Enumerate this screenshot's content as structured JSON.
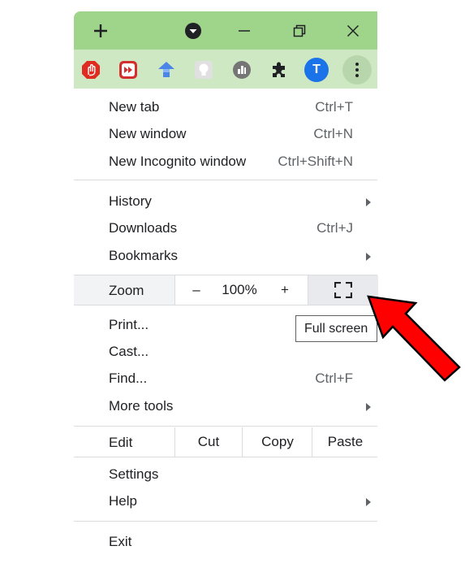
{
  "colors": {
    "titlebar": "#9fd48b",
    "toolbar": "#cfe8c4",
    "annotation_arrow": "#ff0000"
  },
  "titlebar": {
    "buttons": [
      {
        "name": "new-tab",
        "icon": "plus-icon"
      },
      {
        "name": "tab-search",
        "icon": "tab-search-icon"
      },
      {
        "name": "minimize",
        "icon": "minimize-icon"
      },
      {
        "name": "restore",
        "icon": "restore-icon"
      },
      {
        "name": "close",
        "icon": "close-icon"
      }
    ]
  },
  "toolbar": {
    "extensions": [
      {
        "icon": "adblock-icon",
        "color": "#e02b20"
      },
      {
        "icon": "video-speed-icon",
        "color": "#d32f2f"
      },
      {
        "icon": "shield-arrow-icon",
        "color": "#4a86e8"
      },
      {
        "icon": "lightbulb-icon",
        "color": "#bdbdbd"
      },
      {
        "icon": "analytics-icon",
        "color": "#757575"
      },
      {
        "icon": "puzzle-icon",
        "color": "#202124"
      }
    ],
    "profile_initial": "T",
    "profile_color": "#1a73e8",
    "menu_icon": "kebab-menu-icon"
  },
  "menu": {
    "new_tab": {
      "label": "New tab",
      "shortcut": "Ctrl+T"
    },
    "new_window": {
      "label": "New window",
      "shortcut": "Ctrl+N"
    },
    "new_incognito": {
      "label": "New Incognito window",
      "shortcut": "Ctrl+Shift+N"
    },
    "history": {
      "label": "History"
    },
    "downloads": {
      "label": "Downloads",
      "shortcut": "Ctrl+J"
    },
    "bookmarks": {
      "label": "Bookmarks"
    },
    "zoom": {
      "label": "Zoom",
      "minus": "–",
      "value": "100%",
      "plus": "+",
      "fullscreen_icon": "fullscreen-icon"
    },
    "print": {
      "label": "Print..."
    },
    "cast": {
      "label": "Cast..."
    },
    "find": {
      "label": "Find...",
      "shortcut": "Ctrl+F"
    },
    "more_tools": {
      "label": "More tools"
    },
    "edit": {
      "label": "Edit",
      "cut": "Cut",
      "copy": "Copy",
      "paste": "Paste"
    },
    "settings": {
      "label": "Settings"
    },
    "help": {
      "label": "Help"
    },
    "exit": {
      "label": "Exit"
    }
  },
  "tooltip": {
    "text": "Full screen"
  }
}
